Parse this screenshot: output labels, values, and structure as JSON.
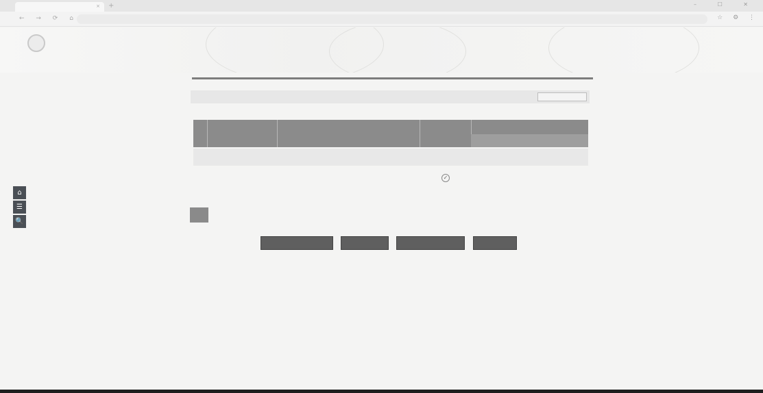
{
  "browser": {
    "tab_title": "",
    "tab_close": "×",
    "new_tab": "+",
    "window_controls": "– ☐ ✕",
    "nav_icons": "← → ⟳ ⌂",
    "url": "",
    "nav_right": "☆ ⚙ ⋮"
  },
  "header": {
    "site_title": "",
    "site_subtitle": "",
    "right_text_1": "",
    "right_text_2": "",
    "right_text_3": ""
  },
  "sidebar": {
    "home_icon": "⌂",
    "list_icon": "☰",
    "search_icon": "🔍"
  },
  "section": {
    "title": "",
    "top_right_button": "",
    "filter_label": "",
    "filter_value": ""
  },
  "table": {
    "headers": {
      "col1": "",
      "col2": "",
      "col3": "",
      "col4": "",
      "col5": "",
      "col6": ""
    },
    "group_row": "",
    "rows": [
      {
        "num": "",
        "id": "",
        "name": "",
        "status_icon": "✓",
        "val1": "",
        "val2": ""
      },
      {
        "num": "",
        "id": "",
        "name": "",
        "status_icon": "",
        "val1": "",
        "val2": ""
      },
      {
        "num": "",
        "id": "",
        "name": "",
        "status_icon": "",
        "val1": "",
        "val2": ""
      }
    ]
  },
  "footer_note": "",
  "buttons": {
    "b1": "",
    "b2": "",
    "b3": "",
    "b4": ""
  },
  "colors": {
    "header_bg": "#8b8b8b",
    "button_bg": "#5f5f5f",
    "sidebar_bg": "#4a4f55"
  }
}
